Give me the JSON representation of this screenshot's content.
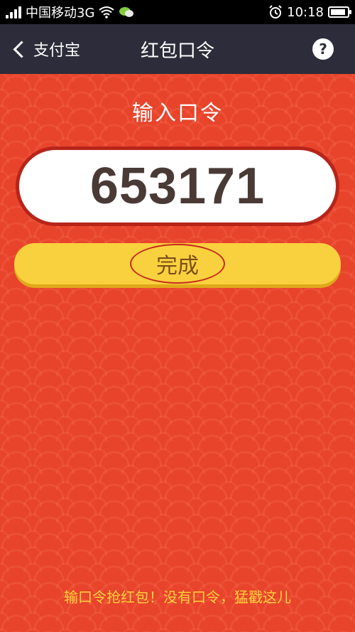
{
  "status_bar": {
    "carrier": "中国移动3G",
    "time": "10:18",
    "battery_level": 0.9,
    "icons": [
      "signal-icon",
      "wifi-icon",
      "chat-notification-icon",
      "alarm-icon",
      "battery-icon"
    ]
  },
  "nav": {
    "back_label": "支付宝",
    "title": "红包口令",
    "help_label": "?"
  },
  "main": {
    "prompt_title": "输入口令",
    "code_value": "653171",
    "done_label": "完成",
    "footer_text": "输口令抢红包！没有口令，猛戳这儿"
  },
  "colors": {
    "background": "#e8432b",
    "nav_bar": "#2c2c3a",
    "button_yellow": "#f9d13e",
    "footer_text": "#ffd43b"
  }
}
